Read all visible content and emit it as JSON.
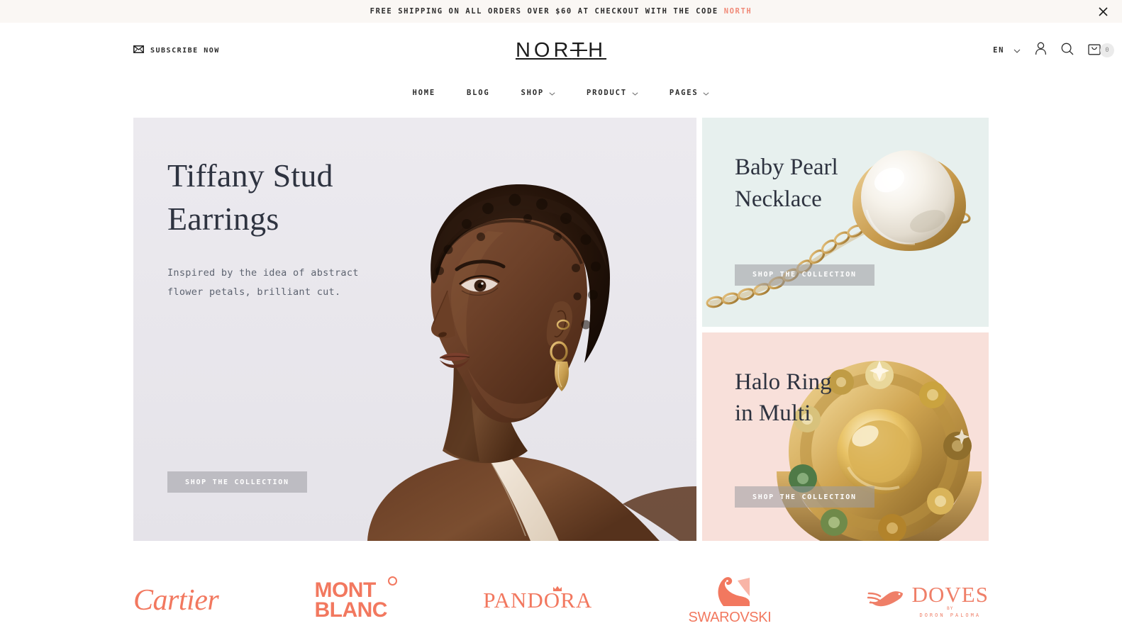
{
  "announcement": {
    "text_before": "FREE SHIPPING ON ALL ORDERS OVER $60 AT CHECKOUT WITH THE CODE",
    "code": "NORTH",
    "close_icon": "close-icon"
  },
  "header": {
    "subscribe_label": "SUBSCRIBE NOW",
    "subscribe_icon": "envelope-icon",
    "logo_part1": "NOR",
    "logo_part2": "T",
    "logo_part3": "H",
    "logo_full": "NORTH",
    "language": "EN",
    "account_icon": "user-icon",
    "search_icon": "search-icon",
    "cart_icon": "shopping-bag-icon",
    "cart_count": "0"
  },
  "nav": {
    "items": [
      {
        "label": "HOME",
        "has_dropdown": false
      },
      {
        "label": "BLOG",
        "has_dropdown": false
      },
      {
        "label": "SHOP",
        "has_dropdown": true
      },
      {
        "label": "PRODUCT",
        "has_dropdown": true
      },
      {
        "label": "PAGES",
        "has_dropdown": true
      }
    ]
  },
  "hero": {
    "main": {
      "title_line1": "Tiffany Stud",
      "title_line2": "Earrings",
      "description": "Inspired by the idea of abstract flower petals, brilliant cut.",
      "cta_label": "SHOP THE COLLECTION",
      "bg_color": "#eceaef"
    },
    "cards": [
      {
        "title_line1": "Baby Pearl",
        "title_line2": "Necklace",
        "cta_label": "SHOP THE COLLECTION",
        "bg_color": "#e7f0ee"
      },
      {
        "title_line1": "Halo Ring",
        "title_line2": "in Multi",
        "cta_label": "SHOP THE COLLECTION",
        "bg_color": "#f8e0da"
      }
    ]
  },
  "brands": {
    "accent_color": "#f2785f",
    "items": [
      {
        "name": "Cartier"
      },
      {
        "name_line1": "MONT",
        "name_line2": "BLANC"
      },
      {
        "name": "PANDORA"
      },
      {
        "name": "SWAROVSKI"
      },
      {
        "name": "DOVES",
        "by": "BY",
        "sub": "DORON PALOMA"
      }
    ]
  }
}
